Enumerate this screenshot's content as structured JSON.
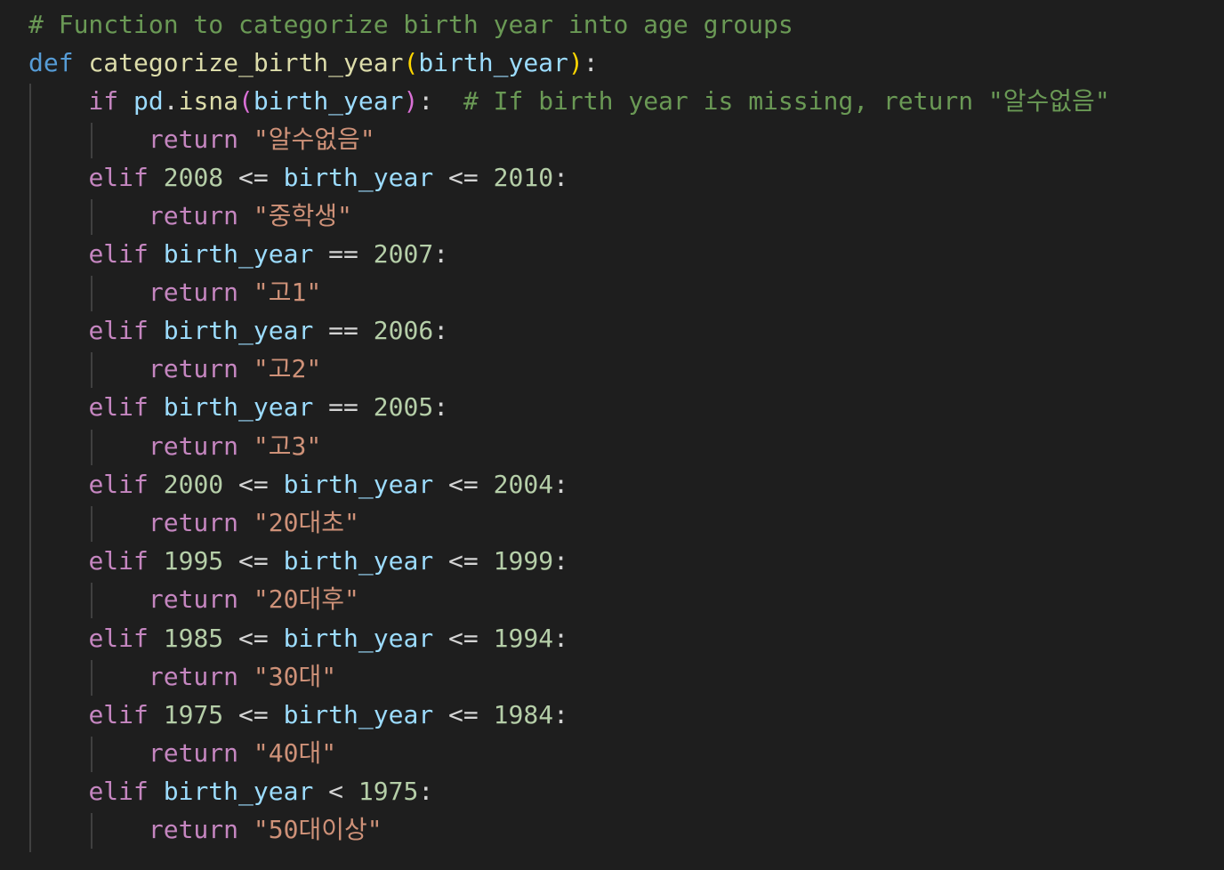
{
  "code": {
    "line1": {
      "comment": "# Function to categorize birth year into age groups"
    },
    "line2": {
      "kw_def": "def",
      "fn_name": "categorize_birth_year",
      "lparen": "(",
      "param": "birth_year",
      "rparen": ")",
      "colon": ":"
    },
    "line3": {
      "kw_if": "if",
      "obj": "pd",
      "dot": ".",
      "method": "isna",
      "lparen": "(",
      "arg": "birth_year",
      "rparen": ")",
      "colon": ":",
      "comment": "# If birth year is missing, return \"알수없음\""
    },
    "line4": {
      "kw_return": "return",
      "value": "\"알수없음\""
    },
    "line5": {
      "kw_elif": "elif",
      "low": "2008",
      "op1": "<=",
      "var": "birth_year",
      "op2": "<=",
      "high": "2010",
      "colon": ":"
    },
    "line6": {
      "kw_return": "return",
      "value": "\"중학생\""
    },
    "line7": {
      "kw_elif": "elif",
      "var": "birth_year",
      "op": "==",
      "num": "2007",
      "colon": ":"
    },
    "line8": {
      "kw_return": "return",
      "value": "\"고1\""
    },
    "line9": {
      "kw_elif": "elif",
      "var": "birth_year",
      "op": "==",
      "num": "2006",
      "colon": ":"
    },
    "line10": {
      "kw_return": "return",
      "value": "\"고2\""
    },
    "line11": {
      "kw_elif": "elif",
      "var": "birth_year",
      "op": "==",
      "num": "2005",
      "colon": ":"
    },
    "line12": {
      "kw_return": "return",
      "value": "\"고3\""
    },
    "line13": {
      "kw_elif": "elif",
      "low": "2000",
      "op1": "<=",
      "var": "birth_year",
      "op2": "<=",
      "high": "2004",
      "colon": ":"
    },
    "line14": {
      "kw_return": "return",
      "value": "\"20대초\""
    },
    "line15": {
      "kw_elif": "elif",
      "low": "1995",
      "op1": "<=",
      "var": "birth_year",
      "op2": "<=",
      "high": "1999",
      "colon": ":"
    },
    "line16": {
      "kw_return": "return",
      "value": "\"20대후\""
    },
    "line17": {
      "kw_elif": "elif",
      "low": "1985",
      "op1": "<=",
      "var": "birth_year",
      "op2": "<=",
      "high": "1994",
      "colon": ":"
    },
    "line18": {
      "kw_return": "return",
      "value": "\"30대\""
    },
    "line19": {
      "kw_elif": "elif",
      "low": "1975",
      "op1": "<=",
      "var": "birth_year",
      "op2": "<=",
      "high": "1984",
      "colon": ":"
    },
    "line20": {
      "kw_return": "return",
      "value": "\"40대\""
    },
    "line21": {
      "kw_elif": "elif",
      "var": "birth_year",
      "op": "<",
      "num": "1975",
      "colon": ":"
    },
    "line22": {
      "kw_return": "return",
      "value": "\"50대이상\""
    }
  },
  "theme": {
    "background": "#1e1e1e",
    "comment": "#6a9955",
    "keyword": "#569cd6",
    "control": "#c586c0",
    "function": "#dcdcaa",
    "variable": "#9cdcfe",
    "number": "#b5cea8",
    "string": "#ce9178"
  }
}
